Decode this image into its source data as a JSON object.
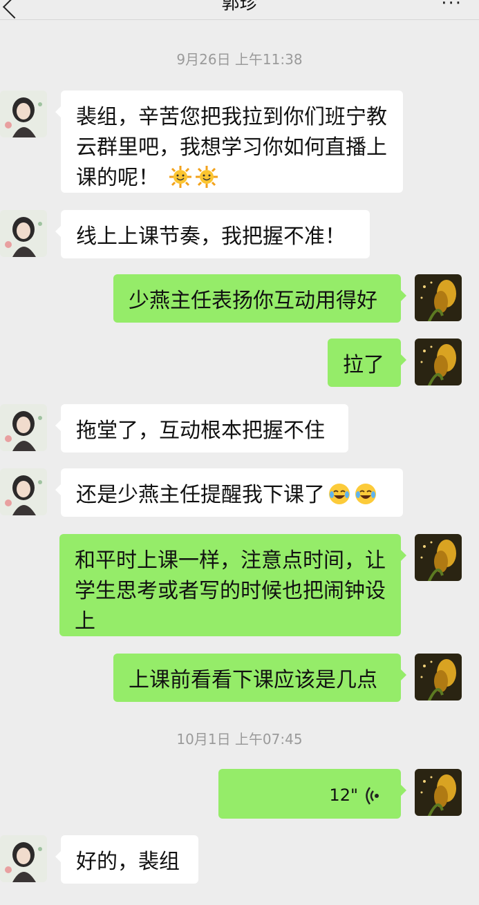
{
  "header": {
    "title": "郭珍",
    "more": "···"
  },
  "timestamps": [
    "9月26日 上午11:38",
    "10月1日 上午07:45"
  ],
  "messages": [
    {
      "from": "other",
      "text": "裴组，辛苦您把我拉到你们班宁教云群里吧，我想学习你如何直播上课的呢！",
      "lines": [
        "裴组，辛苦您把我拉到你们班宁教",
        "云群里吧，我想学习你如何直播上",
        "课的呢！"
      ],
      "emoji": [
        "sun-emoji",
        "sun-emoji"
      ]
    },
    {
      "from": "other",
      "text": "线上上课节奏，我把握不准！"
    },
    {
      "from": "me",
      "text": "少燕主任表扬你互动用得好"
    },
    {
      "from": "me",
      "text": "拉了"
    },
    {
      "from": "other",
      "text": "拖堂了，互动根本把握不住"
    },
    {
      "from": "other",
      "text": "还是少燕主任提醒我下课了",
      "emoji": [
        "laughing-crying-emoji",
        "laughing-crying-emoji"
      ]
    },
    {
      "from": "me",
      "lines": [
        "和平时上课一样，注意点时间，让",
        "学生思考或者写的时候也把闹钟设",
        "上"
      ]
    },
    {
      "from": "me",
      "text": "上课前看看下课应该是几点"
    },
    {
      "from": "me",
      "type": "voice",
      "duration": "12\""
    },
    {
      "from": "other",
      "text": "好的，裴组"
    }
  ],
  "colors": {
    "background": "#ededed",
    "incoming_bubble": "#ffffff",
    "outgoing_bubble": "#95ec69",
    "timestamp": "#9a9a9a"
  }
}
